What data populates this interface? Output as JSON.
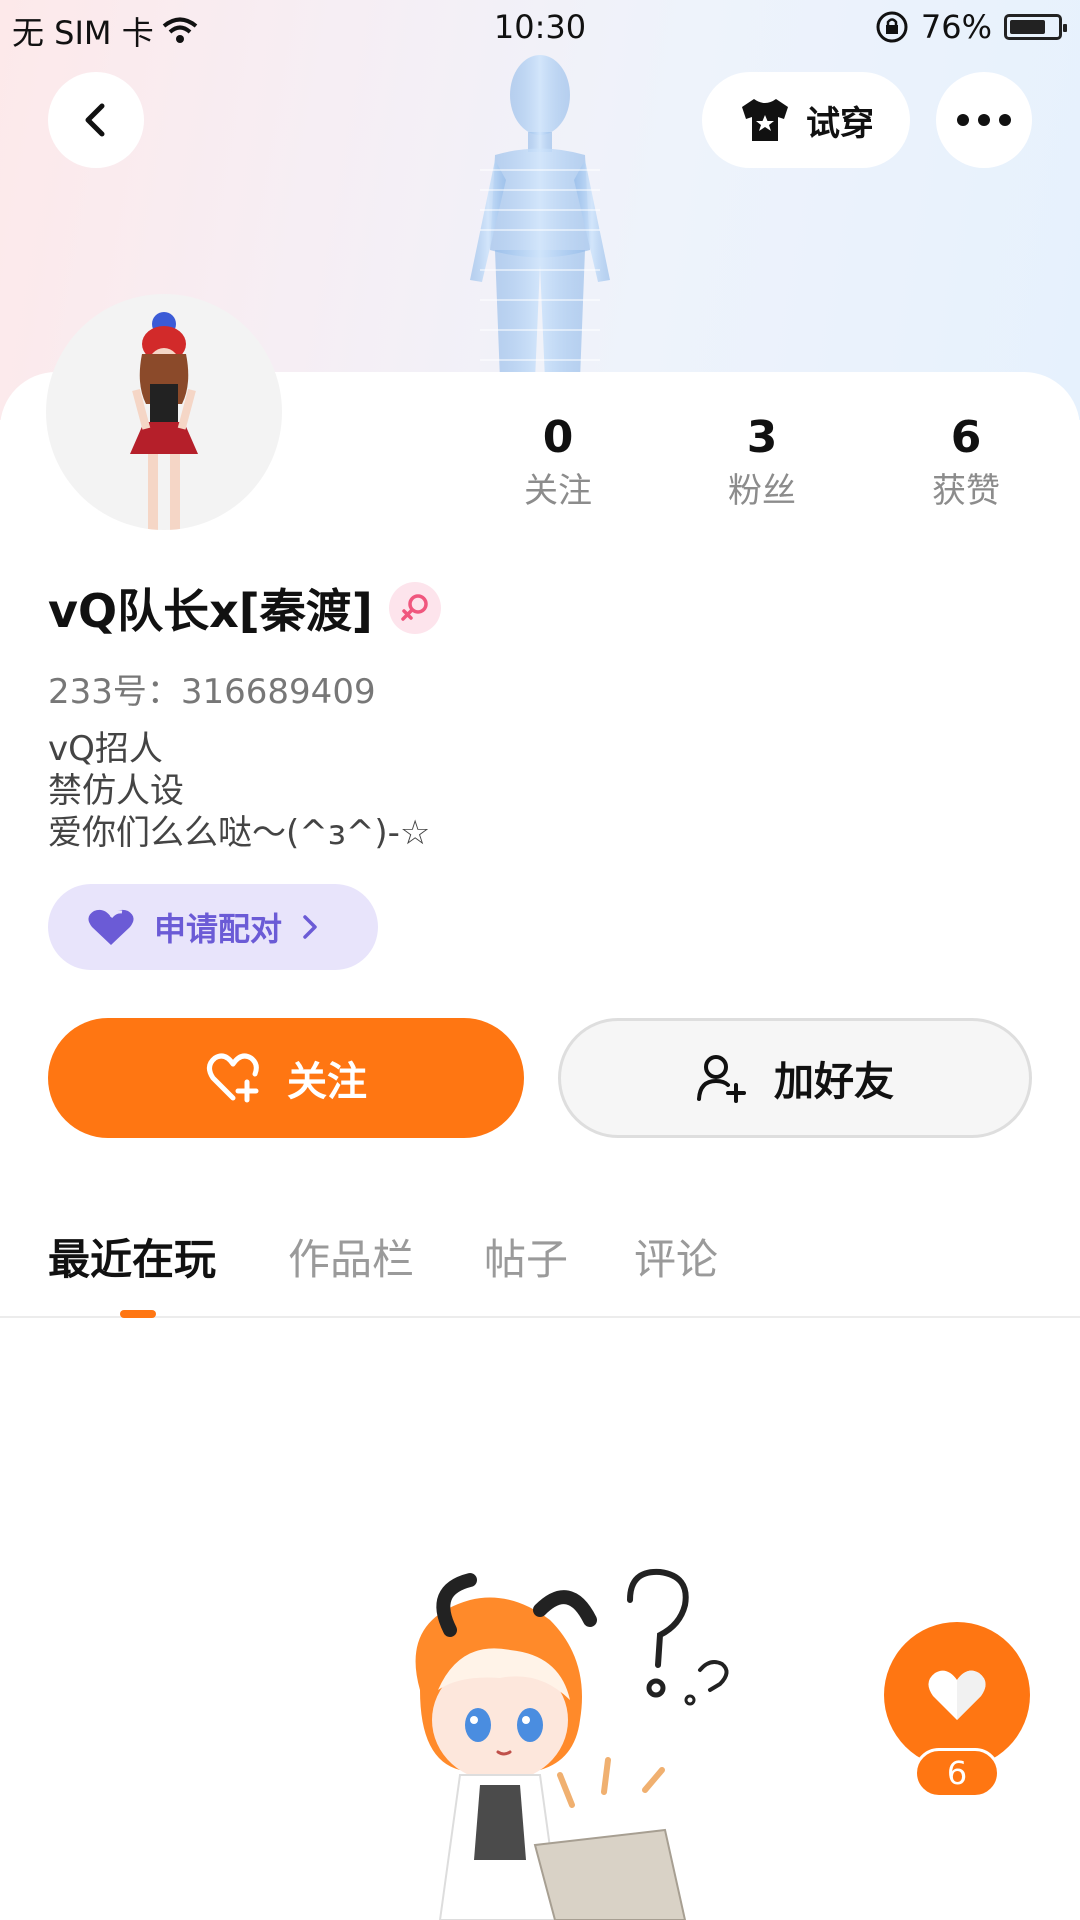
{
  "status_bar": {
    "carrier": "无 SIM 卡",
    "time": "10:30",
    "battery": "76%",
    "battery_level": 0.76
  },
  "header": {
    "tryon_label": "试穿"
  },
  "stats": [
    {
      "value": "0",
      "label": "关注"
    },
    {
      "value": "3",
      "label": "粉丝"
    },
    {
      "value": "6",
      "label": "获赞"
    }
  ],
  "profile": {
    "nickname": "vQ队长x[秦渡]",
    "user_id": "233号：316689409",
    "bio": [
      "vQ招人",
      "禁仿人设",
      "爱你们么么哒～(^з^)-☆"
    ]
  },
  "pair_button": {
    "label": "申请配对"
  },
  "actions": {
    "follow_label": "关注",
    "add_friend_label": "加好友"
  },
  "tabs": [
    {
      "label": "最近在玩",
      "active": true
    },
    {
      "label": "作品栏",
      "active": false
    },
    {
      "label": "帖子",
      "active": false
    },
    {
      "label": "评论",
      "active": false
    }
  ],
  "like_fab": {
    "count": "6"
  },
  "colors": {
    "accent": "#ff7612",
    "pair_bg": "#e8e4fb",
    "pair_text": "#6b5bd6",
    "gender_badge": "#fde4ec"
  }
}
